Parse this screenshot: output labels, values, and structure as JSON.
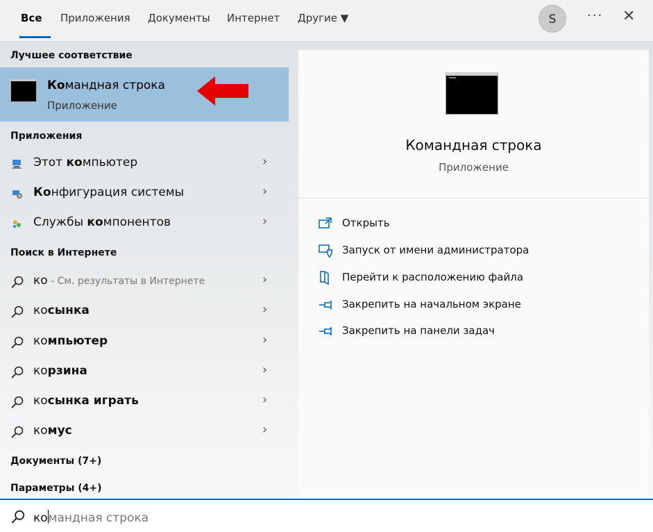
{
  "tabs": [
    {
      "label": "Все",
      "active": true
    },
    {
      "label": "Приложения"
    },
    {
      "label": "Документы"
    },
    {
      "label": "Интернет"
    },
    {
      "label": "Другие ▼"
    }
  ],
  "user_initial": "S",
  "more_icon": "···",
  "close_icon": "✕",
  "sections": {
    "best": "Лучшее соответствие",
    "apps": "Приложения",
    "web": "Поиск в Интернете",
    "docs": "Документы (7+)",
    "settings": "Параметры (4+)"
  },
  "best_match": {
    "bold": "Ко",
    "rest": "мандная строка",
    "sub": "Приложение",
    "arrow_color": "#e30000"
  },
  "apps": [
    {
      "pre": "Этот ",
      "bold": "ко",
      "post": "мпьютер",
      "icon": "computer-icon"
    },
    {
      "pre": "",
      "bold": "Ко",
      "post": "нфигурация системы",
      "icon": "system-config-icon"
    },
    {
      "pre": "Службы ",
      "bold": "ко",
      "post": "мпонентов",
      "icon": "component-services-icon"
    }
  ],
  "web_results": [
    {
      "pre": "",
      "normal": "ко",
      "bold": "",
      "hint": " - См. результаты в Интернете"
    },
    {
      "normal": "ко",
      "bold": "сынка"
    },
    {
      "normal": "ко",
      "bold": "мпьютер"
    },
    {
      "normal": "ко",
      "bold": "рзина"
    },
    {
      "normal": "ко",
      "bold": "сынка играть"
    },
    {
      "normal": "ко",
      "bold": "мус"
    }
  ],
  "chevron": "›",
  "preview": {
    "title": "Командная строка",
    "subtitle": "Приложение",
    "actions": [
      {
        "label": "Открыть",
        "icon": "open-icon"
      },
      {
        "label": "Запуск от имени администратора",
        "icon": "shield-admin-icon"
      },
      {
        "label": "Перейти к расположению файла",
        "icon": "file-location-icon"
      },
      {
        "label": "Закрепить на начальном экране",
        "icon": "pin-icon"
      },
      {
        "label": "Закрепить на панели задач",
        "icon": "pin-icon"
      }
    ]
  },
  "search": {
    "typed": "ко",
    "suggestion": "мандная строка"
  },
  "colors": {
    "accent": "#0067c0",
    "selected": "#9cbfdb",
    "icon_blue": "#0067c0"
  }
}
